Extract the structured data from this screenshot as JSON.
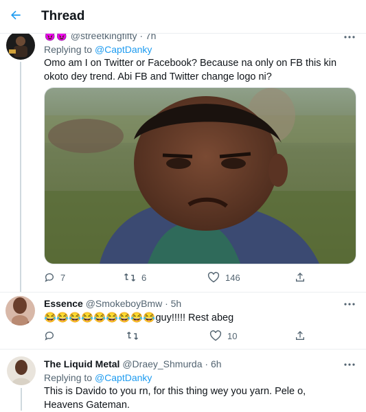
{
  "header": {
    "title": "Thread"
  },
  "tweets": [
    {
      "name_prefix": "😈😈",
      "handle": "@streetkingfifty",
      "time": "· 7h",
      "replying_label": "Replying to",
      "replying_to": "@CaptDanky",
      "text": "Omo am I on Twitter or Facebook? Because na only on FB this kin okoto dey trend. Abi FB and Twitter change logo ni?",
      "counts": {
        "reply": "7",
        "retweet": "6",
        "like": "146"
      }
    },
    {
      "name": "Essence",
      "handle": "@SmokeboyBmw",
      "time": "· 5h",
      "text": "😂😂😂😂😂😂😂😂😂guy!!!!! Rest abeg",
      "counts": {
        "reply": "",
        "retweet": "",
        "like": "10"
      }
    },
    {
      "name": "The Liquid Metal",
      "handle": "@Draey_Shmurda",
      "time": "· 6h",
      "replying_label": "Replying to",
      "replying_to": "@CaptDanky",
      "text": "This is Davido to you rn, for this thing wey you yarn. Pele o, Heavens Gateman."
    }
  ],
  "colors": {
    "accent": "#1d9bf0",
    "muted": "#536471",
    "divider": "#ebeef0"
  }
}
